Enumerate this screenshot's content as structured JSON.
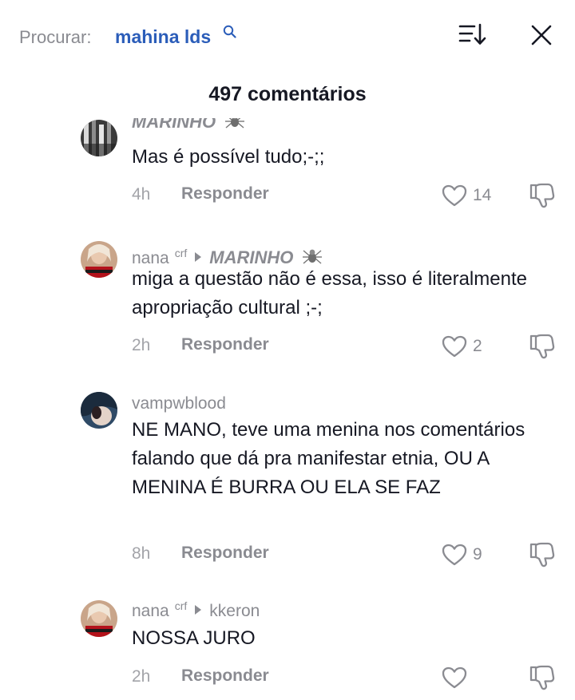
{
  "search": {
    "prefix": "Procurar:",
    "query": "mahina lds"
  },
  "comments_count": "497 comentários",
  "comments": [
    {
      "author": "MARINHO",
      "text": "Mas é possível tudo;-;;",
      "time": "4h",
      "reply_label": "Responder",
      "likes": "14"
    },
    {
      "author": "nana",
      "author_badge": "crf",
      "reply_to": "MARINHO",
      "text": "miga a questão não é essa, isso é literalmente apropriação cultural ;-;",
      "time": "2h",
      "reply_label": "Responder",
      "likes": "2"
    },
    {
      "author": "vampwblood",
      "text": "NE MANO, teve uma menina nos comentários falando que dá pra manifestar etnia, OU A MENINA É BURRA OU ELA SE FAZ",
      "time": "8h",
      "reply_label": "Responder",
      "likes": "9"
    },
    {
      "author": "nana",
      "author_badge": "crf",
      "reply_to": "kkeron",
      "text": "NOSSA JURO",
      "time": "2h",
      "reply_label": "Responder",
      "likes": ""
    }
  ],
  "icons": {
    "search": "search-icon",
    "sort": "sort-icon",
    "close": "close-icon",
    "like": "heart-icon",
    "dislike": "thumbs-down-icon",
    "spider": "spider-emoji-icon"
  },
  "colors": {
    "link": "#2b5db9",
    "secondary": "#8a8b91",
    "text": "#161823"
  }
}
